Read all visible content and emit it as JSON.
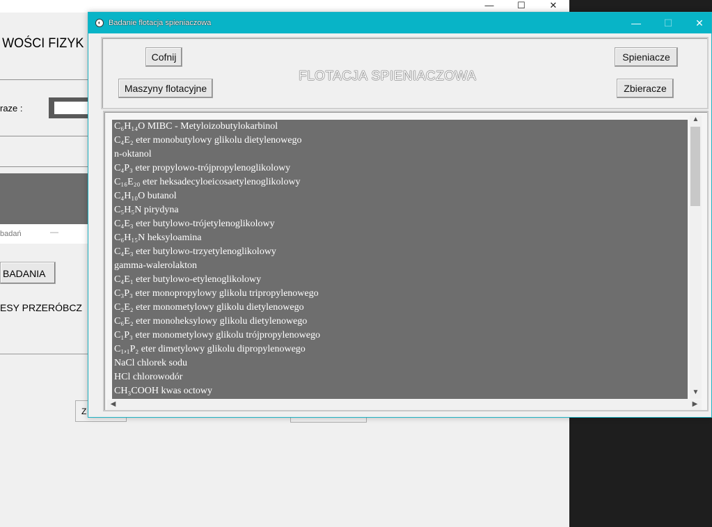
{
  "background_window": {
    "controls": {
      "minimize": "—",
      "maximize": "☐",
      "close": "✕"
    },
    "heading": "WOŚCI FIZYK",
    "field_label": "raze :",
    "sub_window": {
      "title": "badań",
      "minimize": "—",
      "button_label": "BADANIA",
      "text": "ESY PRZERÓBCZ"
    },
    "bottom_button_label": "Z"
  },
  "dialog": {
    "title": "Badanie flotacja spieniaczowa",
    "controls": {
      "minimize": "—",
      "maximize": "☐",
      "close": "✕"
    },
    "buttons": {
      "back": "Cofnij",
      "machines": "Maszyny flotacyjne",
      "frothers": "Spieniacze",
      "collectors": "Zbieracze"
    },
    "heading": "FLOTACJA SPIENIACZOWA",
    "list_items": [
      "C₆H₁₄O MIBC - Metyloizobutylokarbinol",
      "C₄E₂ eter monobutylowy glikolu dietylenowego",
      "n-oktanol",
      "C₄P₃ eter propylowo-trójpropylenoglikolowy",
      "C₁₆E₂₀ eter heksadecyloeicosaetylenoglikolowy",
      "C₄H₁₀O butanol",
      "C₅H₅N pirydyna",
      "C₄E₃ eter butylowo-trójetylenoglikolowy",
      "C₆H₁₅N heksyloamina",
      "C₄E₃ eter butylowo-trzyetylenoglikolowy",
      "gamma-walerolakton",
      "C₄E₁ eter butylowo-etylenoglikolowy",
      "C₃P₃ eter monopropylowy glikolu tripropylenowego",
      "C₂E₂ eter monometylowy glikolu dietylenowego",
      "C₆E₂ eter monoheksylowy glikolu dietylenowego",
      "C₁P₃ eter monometylowy glikolu trójpropylenowego",
      "C₁,₁P₂ eter dimetylowy glikolu dipropylenowego",
      "NaCl chlorek sodu",
      "HCl chlorowodór",
      "CH₃COOH kwas octowy"
    ],
    "scroll": {
      "up": "▲",
      "down": "▼",
      "left": "◀",
      "right": "▶"
    }
  },
  "colors": {
    "titlebar": "#08b4c7",
    "listbox": "#6e6e6e",
    "desktop_dark": "#1e1e1e"
  }
}
